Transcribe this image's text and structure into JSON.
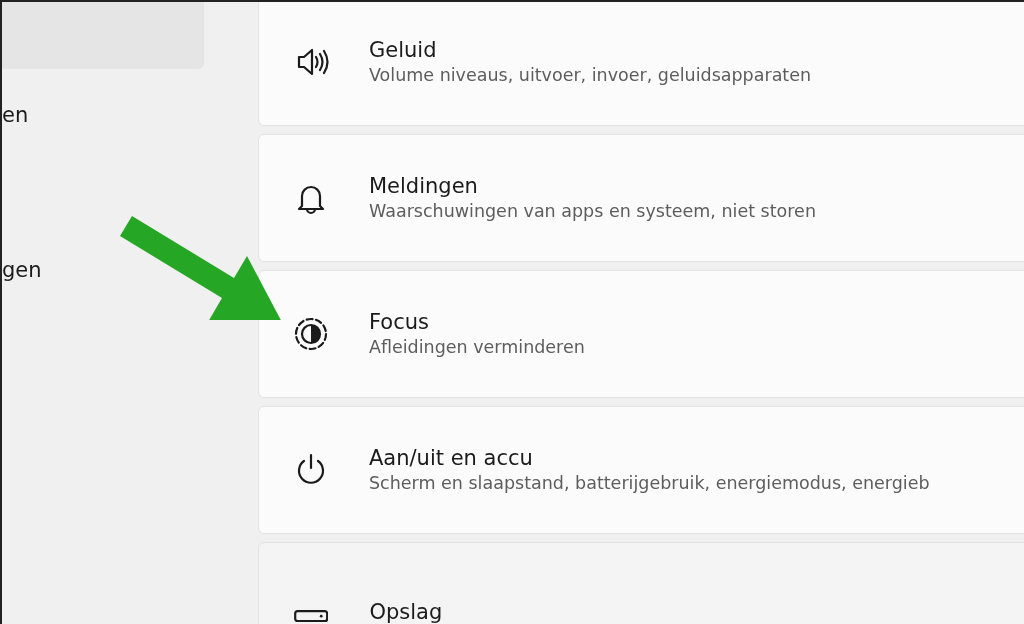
{
  "sidebar": {
    "items": [
      {
        "label": "en",
        "selected": false
      },
      {
        "label": "gen",
        "selected": false
      }
    ],
    "highlight": true
  },
  "settings": [
    {
      "kind": "sound",
      "title": "Geluid",
      "subtitle": "Volume niveaus, uitvoer, invoer, geluidsapparaten"
    },
    {
      "kind": "bell",
      "title": "Meldingen",
      "subtitle": "Waarschuwingen van apps en systeem, niet storen"
    },
    {
      "kind": "focus",
      "title": "Focus",
      "subtitle": "Afleidingen verminderen"
    },
    {
      "kind": "power",
      "title": "Aan/uit en accu",
      "subtitle": "Scherm en slaapstand, batterijgebruik, energiemodus, energieb"
    },
    {
      "kind": "storage",
      "title": "Opslag"
    }
  ]
}
